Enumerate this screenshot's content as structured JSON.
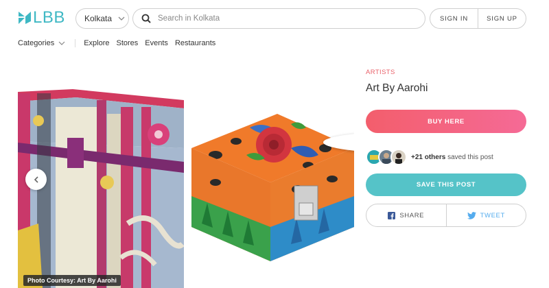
{
  "header": {
    "logo_text": "LBB",
    "city": "Kolkata",
    "search_placeholder": "Search in Kolkata",
    "sign_in": "SIGN IN",
    "sign_up": "SIGN UP"
  },
  "nav": {
    "categories": "Categories",
    "items": [
      "Explore",
      "Stores",
      "Events",
      "Restaurants"
    ]
  },
  "carousel": {
    "credit": "Photo Courtesy: Art By Aarohi"
  },
  "post": {
    "tag": "ARTISTS",
    "title": "Art By Aarohi",
    "buy_label": "BUY HERE",
    "saved_count": "+21 others",
    "saved_suffix": " saved this post",
    "save_label": "SAVE THIS POST",
    "share_label": "SHARE",
    "tweet_label": "TWEET"
  },
  "colors": {
    "brand": "#3fb8c4",
    "tag": "#e9616a",
    "buy_start": "#f35e6c",
    "buy_end": "#f56a96",
    "save": "#55c3c8",
    "twitter": "#55acee"
  }
}
